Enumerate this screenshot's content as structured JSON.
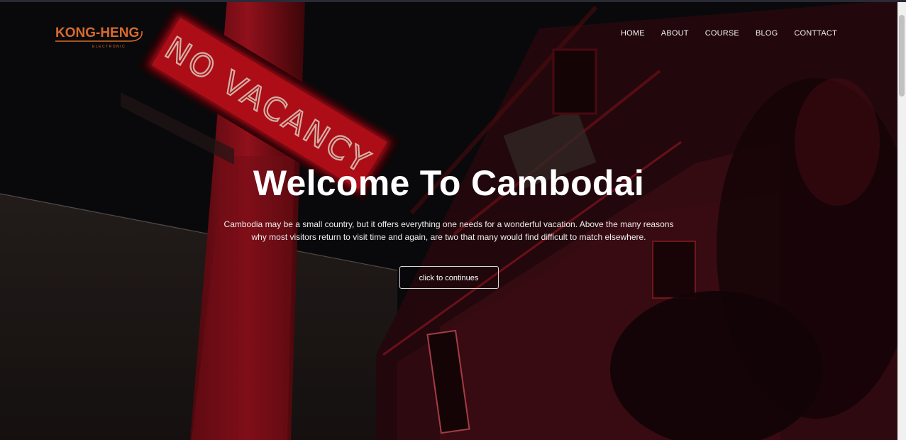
{
  "brand": {
    "logo_text": "KONG-HENG",
    "logo_subtext": "ELECTRONIC",
    "logo_color": "#d86a2b"
  },
  "nav": {
    "items": [
      {
        "label": "HOME"
      },
      {
        "label": "ABOUT"
      },
      {
        "label": "COURSE"
      },
      {
        "label": "BLOG"
      },
      {
        "label": "CONTTACT"
      }
    ]
  },
  "hero": {
    "title": "Welcome To Cambodai",
    "paragraph": "Cambodia may be a small country, but it offers everything one needs for a wonderful vacation. Above the many reasons why most visitors return to visit time and again, are two that many would find difficult to match elsewhere.",
    "button_label": "click to continues",
    "background_image": "neon-no-vacancy-sign-photo",
    "neon_sign_text": "NO VACANCY",
    "accent_color": "#ff1a2a"
  }
}
